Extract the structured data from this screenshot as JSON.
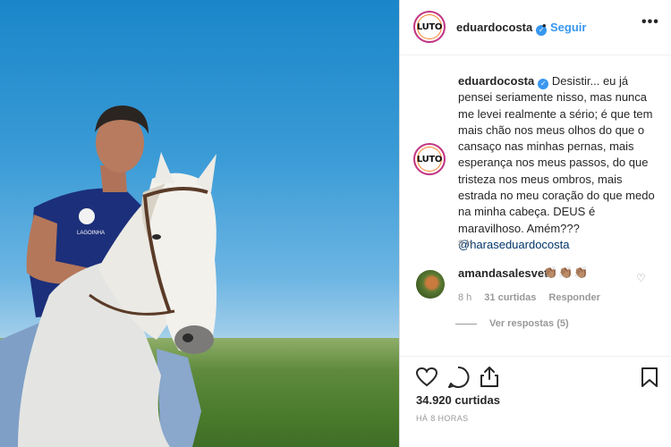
{
  "post": {
    "photo_alt": "Homem de camiseta azul montado em cavalo branco",
    "shirt_text": "LAGOINHA"
  },
  "header": {
    "avatar_text": "LUTO",
    "username": "eduardocosta",
    "verified_icon": "verified-badge-icon",
    "separator": "•",
    "follow_label": "Seguir",
    "more_icon": "more-options-icon",
    "more_label": "•••"
  },
  "caption": {
    "avatar_text": "LUTO",
    "username": "eduardocosta",
    "text": "Desistir... eu já pensei seriamente nisso, mas nunca me levei realmente a sério; é que tem mais chão nos meus olhos do que o cansaço nas minhas pernas, mais esperança nos meus passos, do que tristeza nos meus ombros, mais estrada no meu coração do que medo na minha cabeça. DEUS é maravilhoso. Amém???",
    "mention": "@haraseduardocosta",
    "time": "8 h"
  },
  "comment": {
    "username": "amandasalesvet",
    "emojis": "👏🏽👏🏽👏🏽",
    "time": "8 h",
    "likes": "31 curtidas",
    "reply_label": "Responder",
    "view_replies": "Ver respostas (5)"
  },
  "actions": {
    "like_icon": "heart-icon",
    "comment_icon": "comment-bubble-icon",
    "share_icon": "share-icon",
    "save_icon": "bookmark-icon",
    "likes_count": "34.920 curtidas",
    "posted_ago": "HÁ 8 HORAS"
  },
  "colors": {
    "link": "#3897f0",
    "mention": "#003569",
    "text": "#262626",
    "muted": "#999999"
  }
}
